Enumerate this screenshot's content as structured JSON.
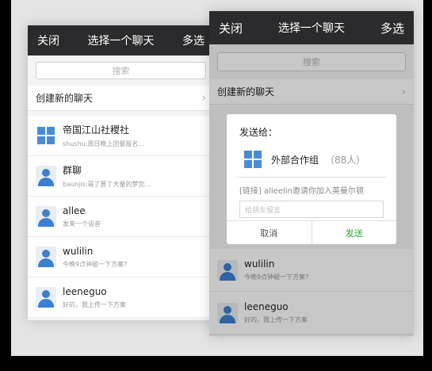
{
  "colors": {
    "topbar": "#2b2b2d",
    "avatar": "#3d7fcf",
    "send_button": "#2fa935"
  },
  "left": {
    "topbar": {
      "close": "关闭",
      "title": "选择一个聊天",
      "multi": "多选"
    },
    "search_placeholder": "搜索",
    "create_chat": "创建新的聊天",
    "items": [
      {
        "name": "帝国江山社稷社",
        "preview": "shushu:周日晚上团餐报名...",
        "avatar_icon": "group-grid-icon"
      },
      {
        "name": "群聊",
        "preview": "baunjis:哥了算了大量的梦您...",
        "avatar_icon": "person-icon"
      },
      {
        "name": "allee",
        "preview": "发来一个语音",
        "avatar_icon": "person-icon"
      },
      {
        "name": "wulilin",
        "preview": "今晚9点钟碰一下方案?",
        "avatar_icon": "person-icon"
      },
      {
        "name": "leeneguo",
        "preview": "好的，我上传一下方案",
        "avatar_icon": "person-icon"
      }
    ]
  },
  "right": {
    "topbar": {
      "close": "关闭",
      "title": "选择一个聊天",
      "multi": "多选"
    },
    "search_placeholder": "搜索",
    "create_chat": "创建新的聊天",
    "dialog": {
      "title": "发送给：",
      "target_name": "外部合作组",
      "target_count": "（88人）",
      "message": "[链接] alleelin邀请你加入英曼尔顿",
      "input_placeholder": "给朋友留言",
      "cancel": "取消",
      "send": "发送"
    },
    "items": [
      {
        "name": "wulilin",
        "preview": "今晚9点钟碰一下方案?",
        "avatar_icon": "person-icon"
      },
      {
        "name": "leeneguo",
        "preview": "好的，我上传一下方案",
        "avatar_icon": "person-icon"
      }
    ]
  }
}
